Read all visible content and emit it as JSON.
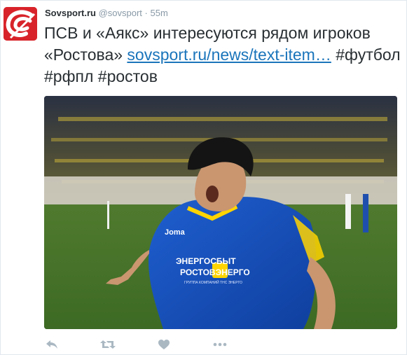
{
  "tweet": {
    "display_name": "Sovsport.ru",
    "handle": "@sovsport",
    "separator": "·",
    "time": "55m",
    "text": "ПСВ и «Аякс» интересуются рядом игроков «Ростова»",
    "link_text": "sovsport.ru/news/text-item…",
    "hashtags": [
      "#футбол",
      "#рфпл",
      "#ростов"
    ]
  },
  "media": {
    "shirt_sponsor_line1": "ЭНЕРГОСБЫТ",
    "shirt_sponsor_line2": "РОСТОВЭНЕРГО",
    "shirt_sponsor_small": "ГРУППА КОМПАНИЙ ТНС ЭНЕРГО",
    "shirt_brand": "Joma"
  },
  "actions": {
    "icons": [
      "reply-icon",
      "retweet-icon",
      "like-icon",
      "more-icon"
    ]
  },
  "colors": {
    "brand": "#d8232a",
    "link": "#1b75bb",
    "muted": "#8899a6",
    "icon": "#aab8c2",
    "text": "#292f33"
  }
}
